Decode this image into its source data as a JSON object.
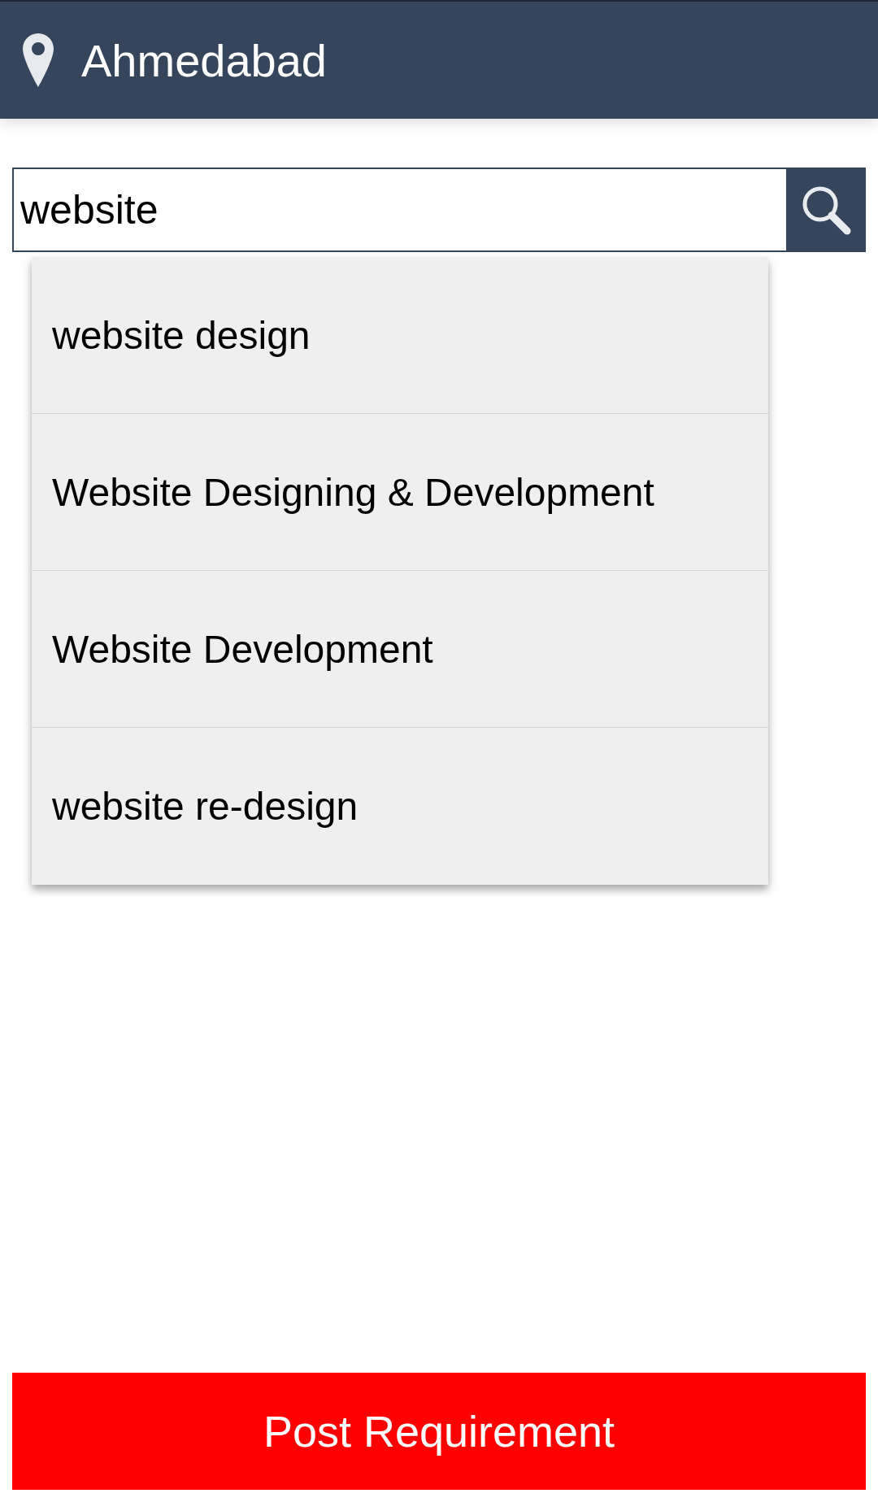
{
  "header": {
    "title": "Ahmedabad"
  },
  "search": {
    "value": "website"
  },
  "suggestions": [
    {
      "label": "website design"
    },
    {
      "label": "Website Designing & Development"
    },
    {
      "label": "Website Development"
    },
    {
      "label": "website re-design"
    }
  ],
  "footer_button": {
    "label": "Post Requirement"
  }
}
